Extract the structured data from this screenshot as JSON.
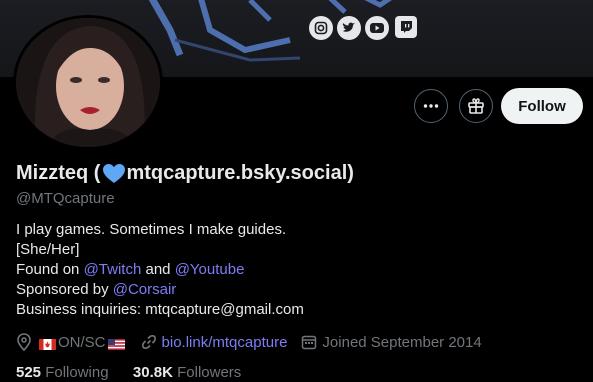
{
  "profile": {
    "display_name_prefix": "Mizzteq (",
    "display_name_suffix": "mtqcapture.bsky.social)",
    "handle": "@MTQcapture",
    "bio": {
      "line1": "I play games. Sometimes I make guides.",
      "line2": "[She/Her]",
      "found_on": "Found on ",
      "twitch": "@Twitch",
      "and": " and ",
      "youtube": "@Youtube",
      "sponsored_by": "Sponsored by ",
      "corsair": "@Corsair",
      "business": "Business inquiries: mtqcapture@gmail.com"
    },
    "location": "ON/SC",
    "website": "bio.link/mtqcapture",
    "joined": "Joined September 2014",
    "following_count": "525",
    "following_label": " Following",
    "followers_count": "30.8K",
    "followers_label": " Followers"
  },
  "actions": {
    "follow_label": "Follow"
  },
  "icons": {
    "more": "more-icon",
    "gift": "gift-icon",
    "location": "location-icon",
    "link": "link-icon",
    "calendar": "calendar-icon"
  },
  "colors": {
    "accent_link": "#7d7cf5",
    "heart": "#5fa8f5",
    "banner_art": "#5a7cc4"
  }
}
